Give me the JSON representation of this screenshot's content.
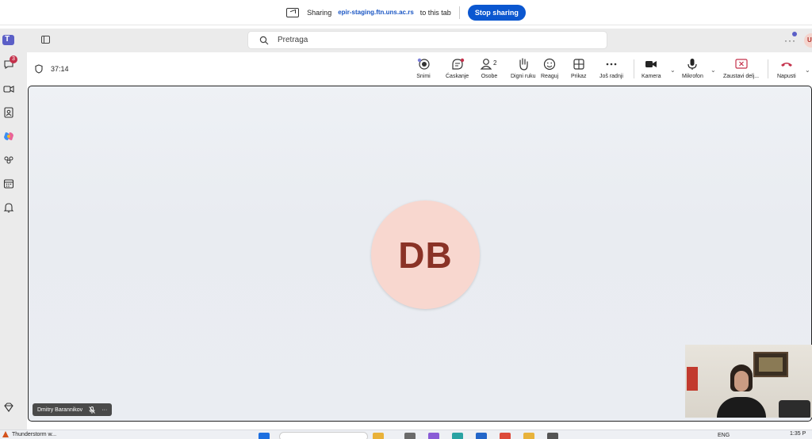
{
  "share_bar": {
    "sharing_label": "Sharing",
    "origin": "epir-staging.ftn.uns.ac.rs",
    "suffix": "to this tab",
    "stop_label": "Stop sharing"
  },
  "top_bar": {
    "search_placeholder": "Pretraga",
    "user_initial": "U"
  },
  "left_rail": {
    "chat_badge": "3",
    "items": [
      "teams-icon",
      "chat-icon",
      "video-icon",
      "contacts-icon",
      "copilot-icon",
      "community-icon",
      "calendar-icon",
      "bell-icon",
      "diamond-icon"
    ]
  },
  "meeting": {
    "timer": "37:14",
    "toolbar": {
      "record": "Snimi",
      "chat": "Ćaskanje",
      "people": "Osobe",
      "people_count": "2",
      "raise_hand": "Digni ruku",
      "react": "Reaguj",
      "view": "Prikaz",
      "more": "Još radnji",
      "camera": "Kamera",
      "mic": "Mikrofon",
      "stop_share": "Zaustavi delj...",
      "leave": "Napusti"
    }
  },
  "stage": {
    "initials": "DB",
    "participant_name": "Dmitry Barannikov"
  },
  "taskbar": {
    "weather": "Thunderstorm w...",
    "lang": "ENG",
    "time": "1:35 P"
  },
  "colors": {
    "accent": "#5b5fc7",
    "stop_button": "#0b57d0",
    "avatar_bg": "#f8d7cf",
    "avatar_text": "#8a3226",
    "leave_red": "#c4314b"
  }
}
